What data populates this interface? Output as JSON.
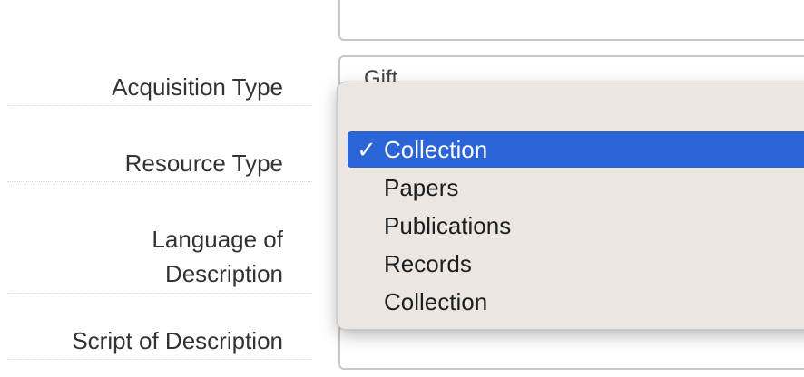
{
  "form": {
    "acquisition_type_label": "Acquisition Type",
    "acquisition_type_value": "Gift",
    "resource_type_label": "Resource Type",
    "language_label_line1": "Language of",
    "language_label_line2": "Description",
    "script_label": "Script of Description"
  },
  "dropdown": {
    "selected_check": "✓",
    "options": [
      {
        "label": "Collection",
        "selected": true
      },
      {
        "label": "Papers",
        "selected": false
      },
      {
        "label": "Publications",
        "selected": false
      },
      {
        "label": "Records",
        "selected": false
      },
      {
        "label": "Collection",
        "selected": false
      }
    ]
  },
  "colors": {
    "selection": "#2a64d6",
    "menu_background": "#ebe6e1"
  }
}
